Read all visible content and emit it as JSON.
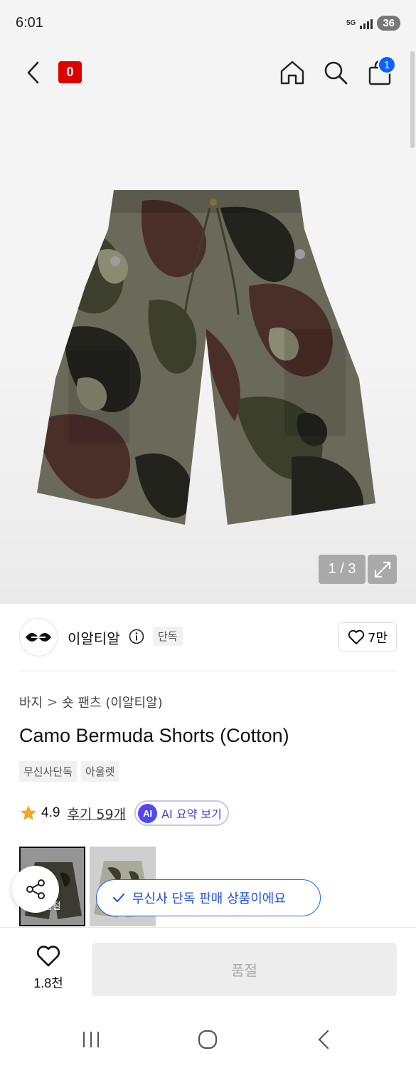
{
  "status_bar": {
    "time": "6:01",
    "network": "5G",
    "battery": "36"
  },
  "top_nav": {
    "badge_text": "0",
    "cart_count": "1"
  },
  "gallery": {
    "counter": "1 / 3"
  },
  "brand": {
    "name": "이알티알",
    "exclusive_tag": "단독",
    "likes": "7만"
  },
  "breadcrumb": {
    "category": "바지",
    "separator": ">",
    "subcategory": "숏 팬츠 (이알티알)"
  },
  "product": {
    "title": "Camo Bermuda Shorts (Cotton)",
    "tags": [
      "무신사단독",
      "아울렛"
    ],
    "rating": "4.9",
    "review_link": "후기 59개",
    "ai_badge": "AI",
    "ai_summary_label": "AI 요약 보기"
  },
  "thumbnails": {
    "soldout_label": "품절"
  },
  "toast": {
    "message": "무신사 단독 판매 상품이에요"
  },
  "bottom_bar": {
    "wish_count": "1.8천",
    "soldout_button": "품절"
  },
  "colors": {
    "accent_blue": "#1a64ff",
    "badge_red": "#dd0000",
    "star": "#f5a623"
  }
}
